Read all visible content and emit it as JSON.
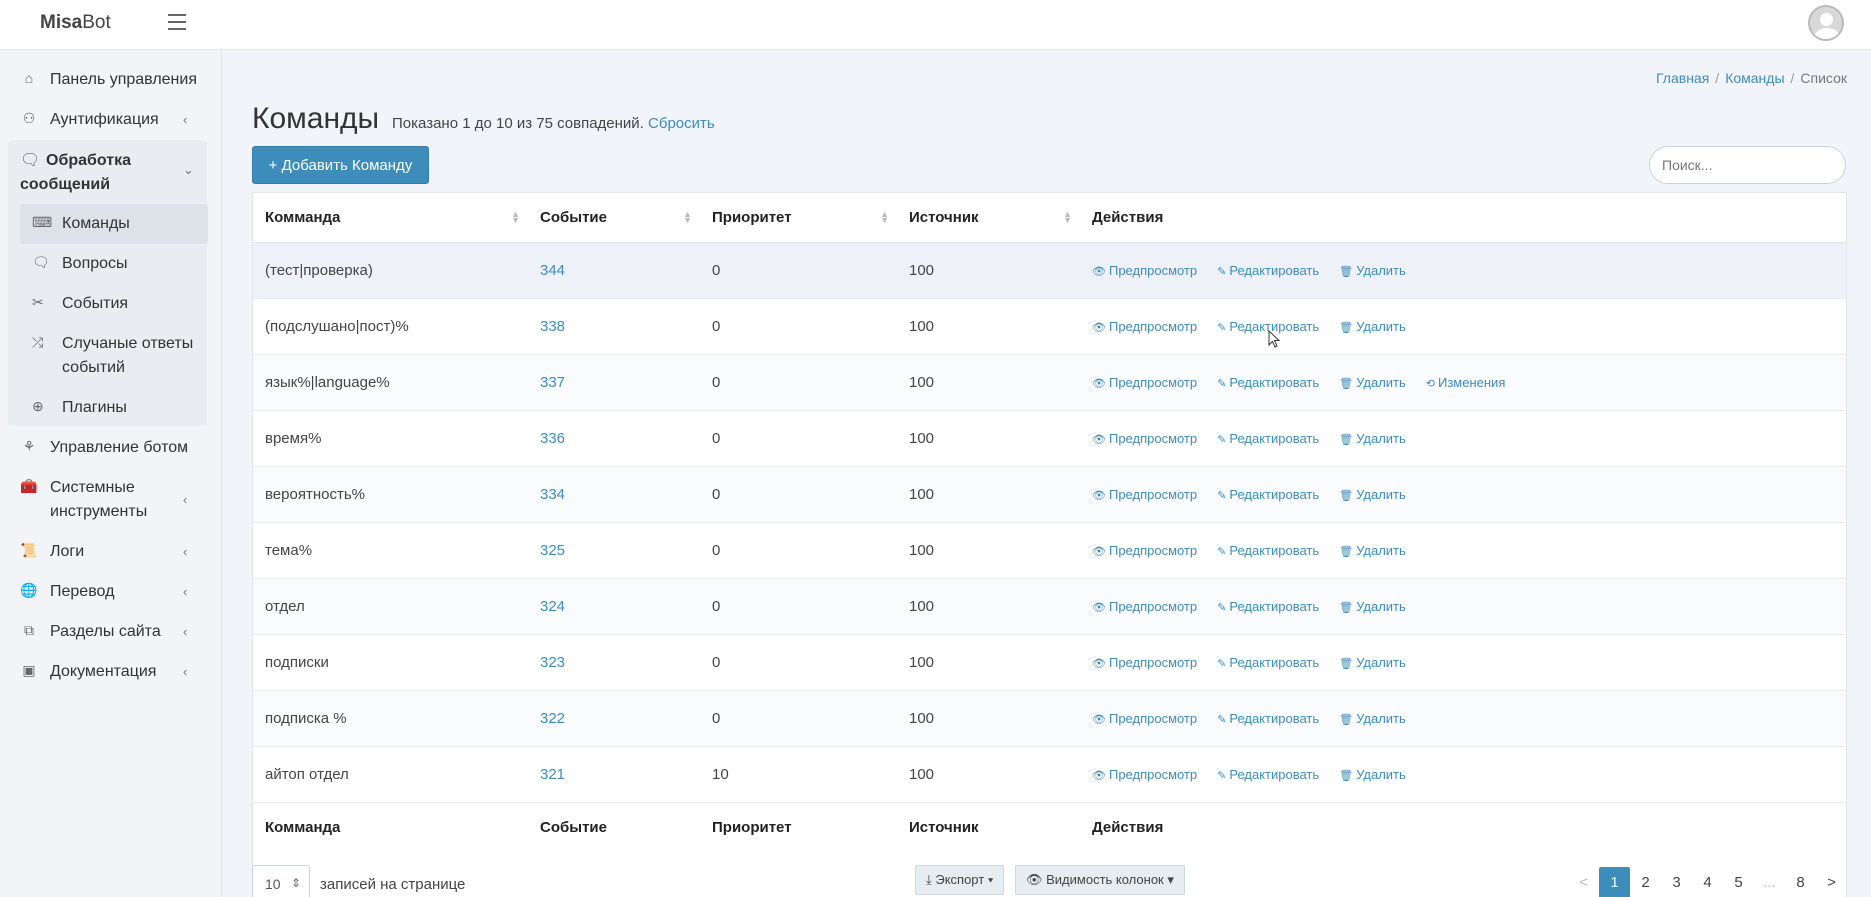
{
  "app": {
    "brand_bold": "Misa",
    "brand_rest": "Bot"
  },
  "sidebar": {
    "items": [
      {
        "label": "Панель управления",
        "icon": "home-icon"
      },
      {
        "label": "Аунтификация",
        "icon": "users-icon"
      },
      {
        "label": "Управление ботом",
        "icon": "sitemap-icon"
      },
      {
        "label": "Системные инструменты",
        "icon": "toolbox-icon"
      },
      {
        "label": "Логи",
        "icon": "scroll-icon"
      },
      {
        "label": "Перевод",
        "icon": "globe-icon"
      },
      {
        "label": "Разделы сайта",
        "icon": "copy-icon"
      },
      {
        "label": "Документация",
        "icon": "book-icon"
      }
    ],
    "group": {
      "title": "Обработка сообщений",
      "children": [
        {
          "label": "Команды",
          "icon": "keyboard-icon"
        },
        {
          "label": "Вопросы",
          "icon": "comments-icon"
        },
        {
          "label": "События",
          "icon": "tools-icon"
        },
        {
          "label": "Случаные ответы событий",
          "icon": "shuffle-icon"
        },
        {
          "label": "Плагины",
          "icon": "plus-circle-icon"
        }
      ]
    }
  },
  "breadcrumb": [
    "Главная",
    "Команды",
    "Список"
  ],
  "page": {
    "title": "Команды",
    "subtitle": "Показано 1 до 10 из 75 совпадений.",
    "reset": "Сбросить",
    "add_button": "+ Добавить Команду",
    "search_placeholder": "Поиск..."
  },
  "table": {
    "headers": [
      "Комманда",
      "Событие",
      "Приоритет",
      "Источник",
      "Действия"
    ],
    "actions": {
      "preview": "Предпросмотр",
      "edit": "Редактировать",
      "delete": "Удалить",
      "changes": "Изменения"
    },
    "rows": [
      {
        "command": "(тест|проверка)",
        "event": "344",
        "priority": "0",
        "source": "100",
        "changes": false
      },
      {
        "command": "(подслушано|пост)%",
        "event": "338",
        "priority": "0",
        "source": "100",
        "changes": false
      },
      {
        "command": "язык%|language%",
        "event": "337",
        "priority": "0",
        "source": "100",
        "changes": true
      },
      {
        "command": "время%",
        "event": "336",
        "priority": "0",
        "source": "100",
        "changes": false
      },
      {
        "command": "вероятность%",
        "event": "334",
        "priority": "0",
        "source": "100",
        "changes": false
      },
      {
        "command": "тема%",
        "event": "325",
        "priority": "0",
        "source": "100",
        "changes": false
      },
      {
        "command": "отдел",
        "event": "324",
        "priority": "0",
        "source": "100",
        "changes": false
      },
      {
        "command": "подписки",
        "event": "323",
        "priority": "0",
        "source": "100",
        "changes": false
      },
      {
        "command": "подписка %",
        "event": "322",
        "priority": "0",
        "source": "100",
        "changes": false
      },
      {
        "command": "айтоп отдел",
        "event": "321",
        "priority": "10",
        "source": "100",
        "changes": false
      }
    ]
  },
  "footer": {
    "per_page": "10",
    "per_page_label": "записей на странице",
    "export": "⤓ Экспорт ▾",
    "columns": "👁 Видимость колонок ▾",
    "pages": [
      "<",
      "1",
      "2",
      "3",
      "4",
      "5",
      "...",
      "8",
      ">"
    ],
    "active_page": "1"
  }
}
